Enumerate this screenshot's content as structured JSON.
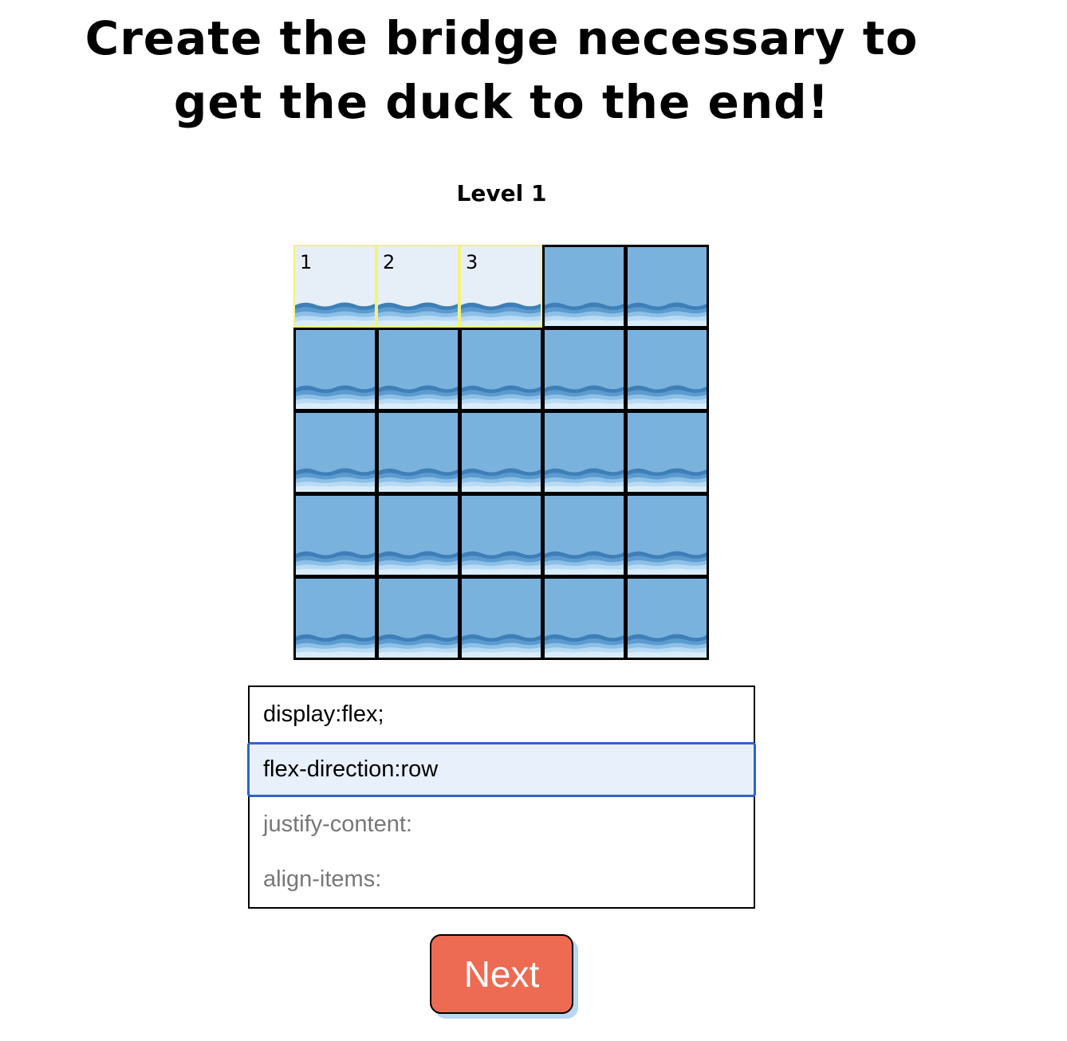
{
  "title": {
    "line1": "Create the bridge necessary to",
    "line2": "get the duck to the end!"
  },
  "level": {
    "label": "Level 1"
  },
  "board": {
    "rows": 5,
    "cols": 5,
    "tile": "water",
    "colors": {
      "water": "#7ab2de",
      "bridge": "#e6eff8",
      "bridge_border": "#f4f27a"
    },
    "bridge_pieces": [
      {
        "label": "1",
        "col": 1,
        "row": 1
      },
      {
        "label": "2",
        "col": 2,
        "row": 1
      },
      {
        "label": "3",
        "col": 3,
        "row": 1
      }
    ]
  },
  "editor": {
    "lines": [
      {
        "text": "display:flex;",
        "state": "filled"
      },
      {
        "text": "flex-direction:row",
        "state": "active"
      },
      {
        "text": "justify-content:",
        "state": "placeholder"
      },
      {
        "text": "align-items:",
        "state": "placeholder"
      }
    ]
  },
  "next_button": {
    "label": "Next",
    "color": "#ec6b52"
  }
}
